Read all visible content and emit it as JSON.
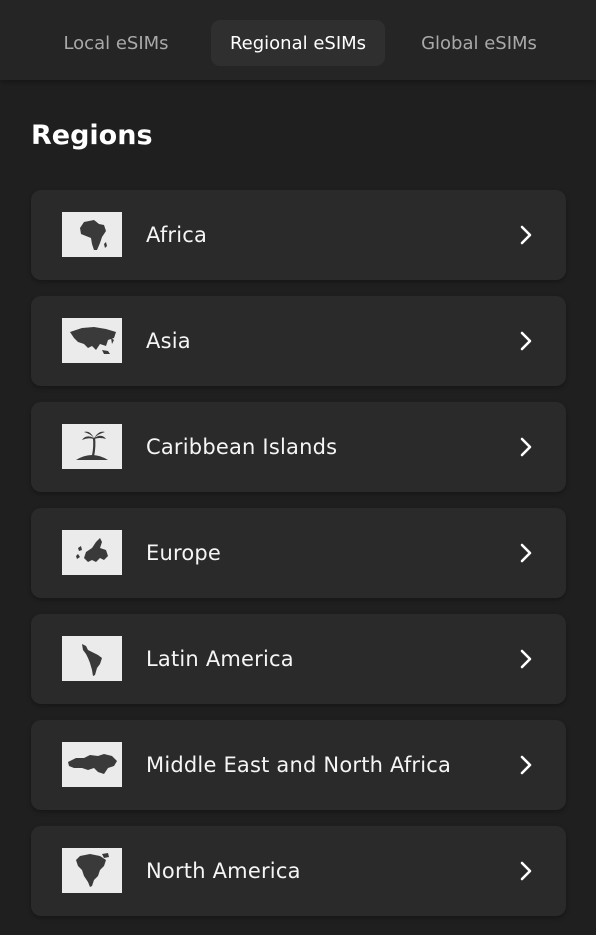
{
  "tabs": [
    {
      "label": "Local eSIMs",
      "active": false
    },
    {
      "label": "Regional eSIMs",
      "active": true
    },
    {
      "label": "Global eSIMs",
      "active": false
    }
  ],
  "section_title": "Regions",
  "regions": [
    {
      "label": "Africa",
      "icon": "africa-map-icon"
    },
    {
      "label": "Asia",
      "icon": "asia-map-icon"
    },
    {
      "label": "Caribbean Islands",
      "icon": "palm-island-icon"
    },
    {
      "label": "Europe",
      "icon": "europe-map-icon"
    },
    {
      "label": "Latin America",
      "icon": "latin-america-map-icon"
    },
    {
      "label": "Middle East and North Africa",
      "icon": "mena-map-icon"
    },
    {
      "label": "North America",
      "icon": "north-america-map-icon"
    }
  ],
  "colors": {
    "background": "#1f1f1f",
    "card": "#2a2a2a",
    "active_tab": "#2f2f2f",
    "text": "#f5f5f5",
    "muted_text": "#a9a9a9",
    "thumb_bg": "#ebebeb",
    "map_fill": "#3a3a3a"
  }
}
